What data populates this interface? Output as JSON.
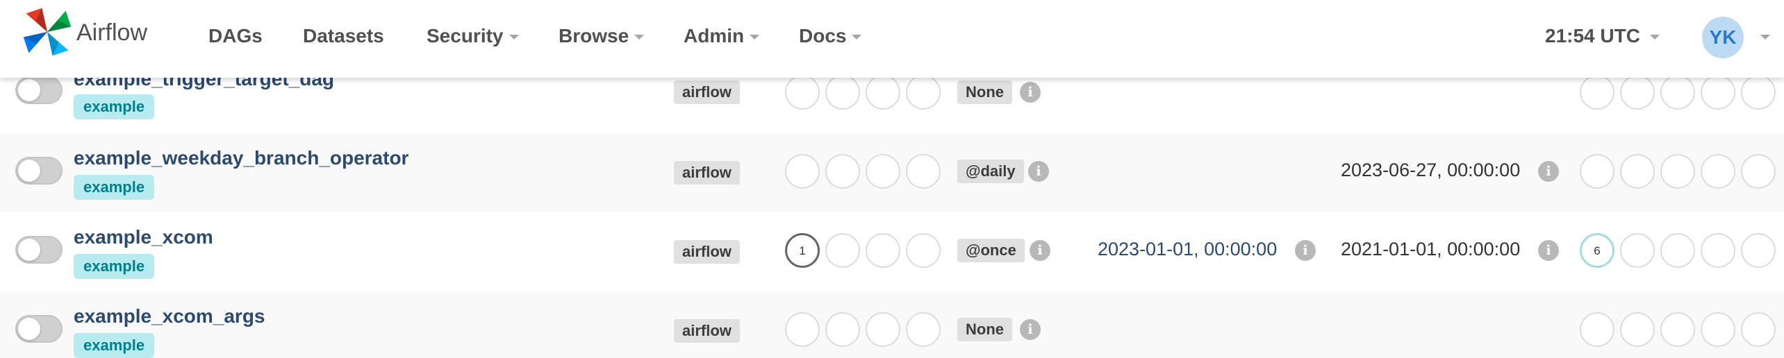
{
  "navbar": {
    "brand": "Airflow",
    "items": [
      {
        "label": "DAGs"
      },
      {
        "label": "Datasets"
      },
      {
        "label": "Security"
      },
      {
        "label": "Browse"
      },
      {
        "label": "Admin"
      },
      {
        "label": "Docs"
      }
    ],
    "clock": "21:54 UTC",
    "user_initials": "YK"
  },
  "dags": [
    {
      "name": "example_trigger_target_dag",
      "tag": "example",
      "owner": "airflow",
      "run_counts": [
        null,
        null,
        null,
        null
      ],
      "schedule": "None",
      "last_run": "",
      "next_run": "",
      "task_counts": [
        null,
        null,
        null,
        null,
        null
      ]
    },
    {
      "name": "example_weekday_branch_operator",
      "tag": "example",
      "owner": "airflow",
      "run_counts": [
        null,
        null,
        null,
        null
      ],
      "schedule": "@daily",
      "last_run": "",
      "next_run": "2023-06-27, 00:00:00",
      "task_counts": [
        null,
        null,
        null,
        null,
        null
      ]
    },
    {
      "name": "example_xcom",
      "tag": "example",
      "owner": "airflow",
      "run_counts": [
        "1",
        null,
        null,
        null
      ],
      "schedule": "@once",
      "last_run": "2023-01-01, 00:00:00",
      "next_run": "2021-01-01, 00:00:00",
      "task_counts": [
        "6",
        null,
        null,
        null,
        null
      ]
    },
    {
      "name": "example_xcom_args",
      "tag": "example",
      "owner": "airflow",
      "run_counts": [
        null,
        null,
        null,
        null
      ],
      "schedule": "None",
      "last_run": "",
      "next_run": "",
      "task_counts": [
        null,
        null,
        null,
        null,
        null
      ]
    }
  ],
  "icons": {
    "info": "info-icon",
    "logo": "airflow-pinwheel-logo"
  },
  "colors": {
    "dag_link": "#2c4a6e",
    "tag_bg": "#b8ebf0",
    "tag_text": "#017f8d",
    "avatar_bg": "#bcdaf4",
    "running_ring": "#a8d8e6"
  }
}
